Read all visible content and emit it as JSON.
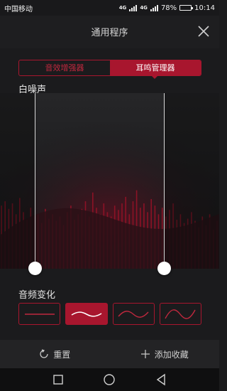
{
  "status_bar": {
    "carrier": "中国移动",
    "network_1": "4G",
    "network_2": "4G",
    "battery_text": "78%",
    "battery_level": 0.78,
    "time": "10:14"
  },
  "header": {
    "title": "通用程序",
    "close_icon": "close-icon"
  },
  "segmented_control": {
    "tabs": [
      {
        "label": "音效增强器",
        "selected": false
      },
      {
        "label": "耳鸣管理器",
        "selected": true
      }
    ]
  },
  "white_noise": {
    "label": "白噪声",
    "low_cutoff_fraction": 0.16,
    "high_cutoff_fraction": 0.75,
    "bar_levels": [
      0.58,
      0.62,
      0.55,
      0.6,
      0.5,
      0.65,
      0.52,
      0.45,
      0.56,
      0.48,
      0.5,
      0.42,
      0.55,
      0.46,
      0.5,
      0.44,
      0.48,
      0.4,
      0.52,
      0.58,
      0.45,
      0.5,
      0.55,
      0.62,
      0.48,
      0.7,
      0.56,
      0.5,
      0.6,
      0.52,
      0.48,
      0.58,
      0.54,
      0.6,
      0.66,
      0.5,
      0.62,
      0.72,
      0.56,
      0.6,
      0.52,
      0.64,
      0.58,
      0.5,
      0.56,
      0.48,
      0.54,
      0.6,
      0.45,
      0.5,
      0.42,
      0.46,
      0.52,
      0.44,
      0.38,
      0.48,
      0.4,
      0.5,
      0.36,
      0.44
    ]
  },
  "frequency_change": {
    "label": "音频变化",
    "options": [
      {
        "icon": "flat-line-icon",
        "selected": false
      },
      {
        "icon": "gentle-wave-icon",
        "selected": true
      },
      {
        "icon": "medium-wave-icon",
        "selected": false
      },
      {
        "icon": "strong-wave-icon",
        "selected": false
      }
    ]
  },
  "bottom_actions": {
    "reset_label": "重置",
    "add_favorite_label": "添加收藏"
  },
  "colors": {
    "accent": "#a8162e",
    "bar": "#8c1226",
    "background": "#1b1b1d"
  }
}
